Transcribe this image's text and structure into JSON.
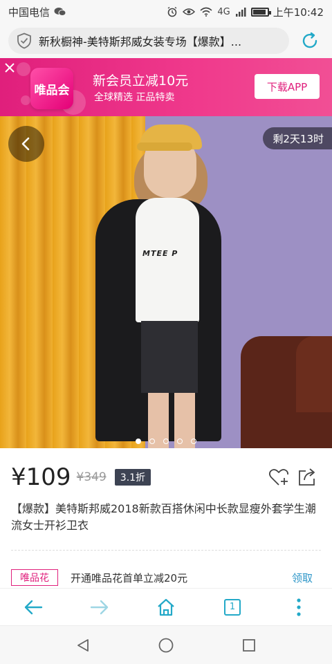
{
  "status_bar": {
    "carrier": "中国电信",
    "network": "4G",
    "time": "上午10:42"
  },
  "url_bar": {
    "title": "新秋橱神-美特斯邦威女装专场【爆款】..."
  },
  "promo": {
    "app_name": "唯品会",
    "title": "新会员立减10元",
    "subtitle": "全球精选 正品特卖",
    "download_label": "下载APP",
    "brand_color": "#e01f7c"
  },
  "hero": {
    "countdown": "剩2天13时",
    "shirt_text": "MTEE P",
    "carousel_count": 5,
    "carousel_active": 0
  },
  "product": {
    "price": "¥109",
    "original_price": "¥349",
    "discount": "3.1折",
    "title": "【爆款】美特斯邦威2018新款百搭休闲中长款显瘦外套学生潮流女士开衫卫衣"
  },
  "coupon": {
    "tag": "唯品花",
    "text": "开通唯品花首单立减20元",
    "claim_label": "领取",
    "link_color": "#2d96c8"
  },
  "toolbar": {
    "tab_count": "1",
    "icon_color": "#23a9c8"
  }
}
